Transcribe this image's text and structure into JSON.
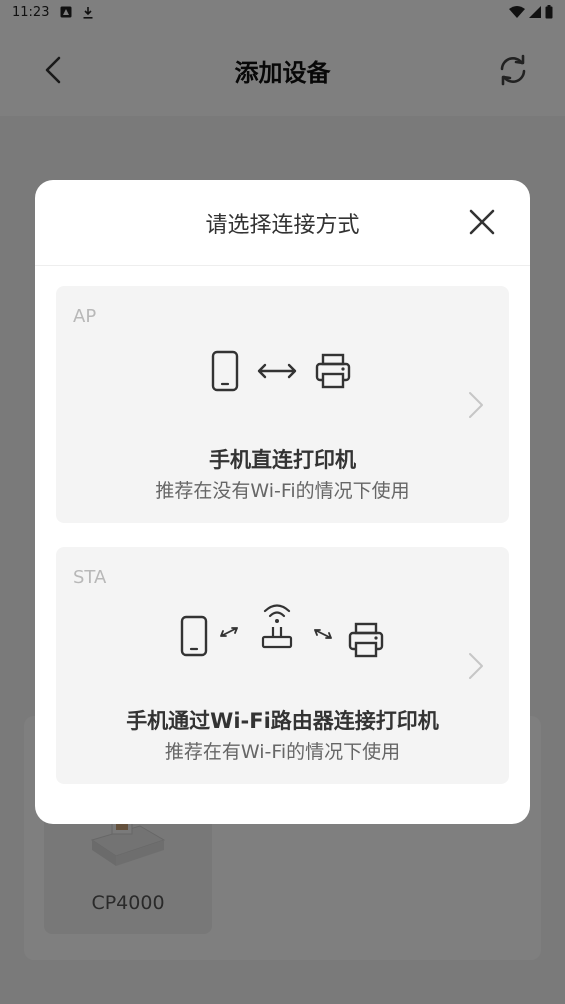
{
  "status_bar": {
    "time": "11:23"
  },
  "app_bar": {
    "title": "添加设备"
  },
  "device_list": {
    "items": [
      {
        "name": "CP4000"
      }
    ]
  },
  "dialog": {
    "title": "请选择连接方式",
    "options": [
      {
        "tag": "AP",
        "title": "手机直连打印机",
        "subtitle": "推荐在没有Wi-Fi的情况下使用"
      },
      {
        "tag": "STA",
        "title": "手机通过Wi-Fi路由器连接打印机",
        "subtitle": "推荐在有Wi-Fi的情况下使用"
      }
    ]
  },
  "colors": {
    "overlay": "#000000",
    "card_bg": "#f4f4f4",
    "dialog_bg": "#ffffff",
    "text_primary": "#333333",
    "text_muted": "#b8b8b8"
  }
}
